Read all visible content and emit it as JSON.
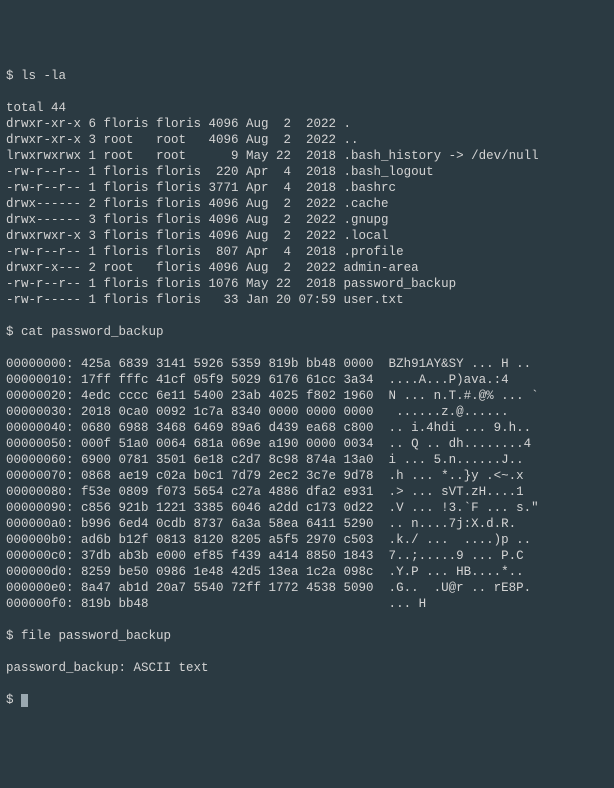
{
  "cmd1": "$ ls -la",
  "ls_output": [
    "total 44",
    "drwxr-xr-x 6 floris floris 4096 Aug  2  2022 .",
    "drwxr-xr-x 3 root   root   4096 Aug  2  2022 ..",
    "lrwxrwxrwx 1 root   root      9 May 22  2018 .bash_history -> /dev/null",
    "-rw-r--r-- 1 floris floris  220 Apr  4  2018 .bash_logout",
    "-rw-r--r-- 1 floris floris 3771 Apr  4  2018 .bashrc",
    "drwx------ 2 floris floris 4096 Aug  2  2022 .cache",
    "drwx------ 3 floris floris 4096 Aug  2  2022 .gnupg",
    "drwxrwxr-x 3 floris floris 4096 Aug  2  2022 .local",
    "-rw-r--r-- 1 floris floris  807 Apr  4  2018 .profile",
    "drwxr-x--- 2 root   floris 4096 Aug  2  2022 admin-area",
    "-rw-r--r-- 1 floris floris 1076 May 22  2018 password_backup",
    "-rw-r----- 1 floris floris   33 Jan 20 07:59 user.txt"
  ],
  "cmd2": "$ cat password_backup",
  "hexdump": [
    "00000000: 425a 6839 3141 5926 5359 819b bb48 0000  BZh91AY&SY ... H ..",
    "00000010: 17ff fffc 41cf 05f9 5029 6176 61cc 3a34  ....A...P)ava.:4",
    "00000020: 4edc cccc 6e11 5400 23ab 4025 f802 1960  N ... n.T.#.@% ... `",
    "00000030: 2018 0ca0 0092 1c7a 8340 0000 0000 0000   ......z.@......",
    "00000040: 0680 6988 3468 6469 89a6 d439 ea68 c800  .. i.4hdi ... 9.h..",
    "00000050: 000f 51a0 0064 681a 069e a190 0000 0034  .. Q .. dh........4",
    "00000060: 6900 0781 3501 6e18 c2d7 8c98 874a 13a0  i ... 5.n......J..",
    "00000070: 0868 ae19 c02a b0c1 7d79 2ec2 3c7e 9d78  .h ... *..}y .<~.x",
    "00000080: f53e 0809 f073 5654 c27a 4886 dfa2 e931  .> ... sVT.zH....1",
    "00000090: c856 921b 1221 3385 6046 a2dd c173 0d22  .V ... !3.`F ... s.\"",
    "000000a0: b996 6ed4 0cdb 8737 6a3a 58ea 6411 5290  .. n....7j:X.d.R.",
    "000000b0: ad6b b12f 0813 8120 8205 a5f5 2970 c503  .k./ ...  ....)p ..",
    "000000c0: 37db ab3b e000 ef85 f439 a414 8850 1843  7..;.....9 ... P.C",
    "000000d0: 8259 be50 0986 1e48 42d5 13ea 1c2a 098c  .Y.P ... HB....*..",
    "000000e0: 8a47 ab1d 20a7 5540 72ff 1772 4538 5090  .G..  .U@r .. rE8P.",
    "000000f0: 819b bb48                                ... H"
  ],
  "cmd3": "$ file password_backup",
  "file_output": "password_backup: ASCII text",
  "cmd4": "$ "
}
